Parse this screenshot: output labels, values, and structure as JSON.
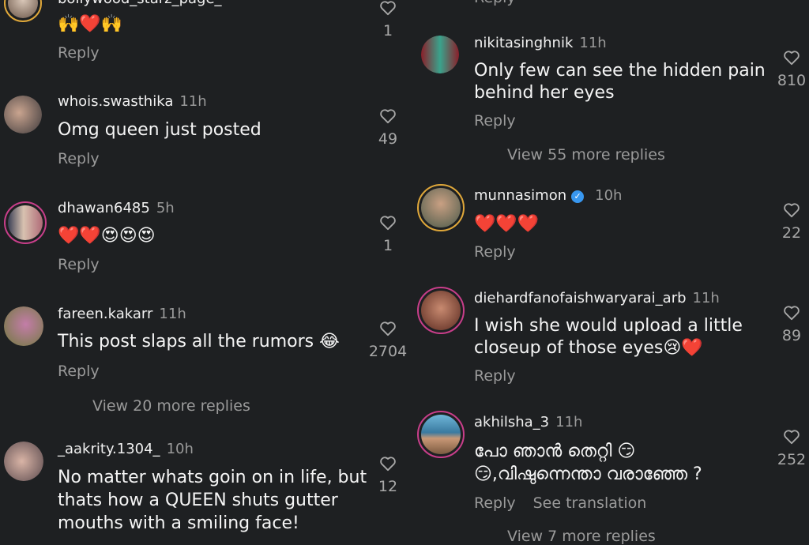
{
  "left_comments": [
    {
      "username": "bollywood_starz_page_",
      "time": "",
      "text": [
        "🙌❤️🙌"
      ],
      "reply": "Reply",
      "likes": "1"
    },
    {
      "username": "whois.swasthika",
      "time": "11h",
      "text": [
        "Omg queen just posted"
      ],
      "reply": "Reply",
      "likes": "49"
    },
    {
      "username": "dhawan6485",
      "time": "5h",
      "text": [
        "❤️❤️😍😍😍"
      ],
      "reply": "Reply",
      "likes": "1"
    },
    {
      "username": "fareen.kakarr",
      "time": "11h",
      "text": [
        "This post slaps all the rumors 😂"
      ],
      "reply": "Reply",
      "likes": "2704",
      "more_replies": "View 20 more replies"
    },
    {
      "username": "_aakrity.1304_",
      "time": "10h",
      "text": [
        "No matter whats goin on in life, but",
        "thats how a QUEEN shuts gutter",
        "mouths with a smiling face!"
      ],
      "reply": "",
      "likes": "12"
    }
  ],
  "right_comments": [
    {
      "username": "nikitasinghnik",
      "time": "11h",
      "text": [
        "Only few can see the hidden pain",
        "behind her eyes"
      ],
      "reply": "Reply",
      "likes": "810",
      "more_replies": "View 55 more replies"
    },
    {
      "username": "munnasimon",
      "time": "10h",
      "text": [
        "❤️❤️❤️"
      ],
      "reply": "Reply",
      "likes": "22",
      "verified": true
    },
    {
      "username": "diehardfanofaishwaryarai_arb",
      "time": "11h",
      "text": [
        "I wish she would upload a little",
        "closeup of those eyes😢❤️"
      ],
      "reply": "Reply",
      "likes": "89"
    },
    {
      "username": "akhilsha_3",
      "time": "11h",
      "text": [
        "പോ ഞാൻ തെറ്റി 😏",
        "😏,വിഷുന്നെന്താ വരാഞ്ഞേ ?"
      ],
      "reply": "Reply",
      "see_translation": "See translation",
      "likes": "252",
      "more_replies": "View 7 more replies"
    }
  ],
  "top_right_reply": "Reply",
  "colors": {
    "background": "#1e2022",
    "muted": "#9a9a9a",
    "story_ring": "#e0a83a",
    "verified": "#3897f0"
  },
  "icons": [
    "heart-outline-icon",
    "verified-badge-icon"
  ]
}
